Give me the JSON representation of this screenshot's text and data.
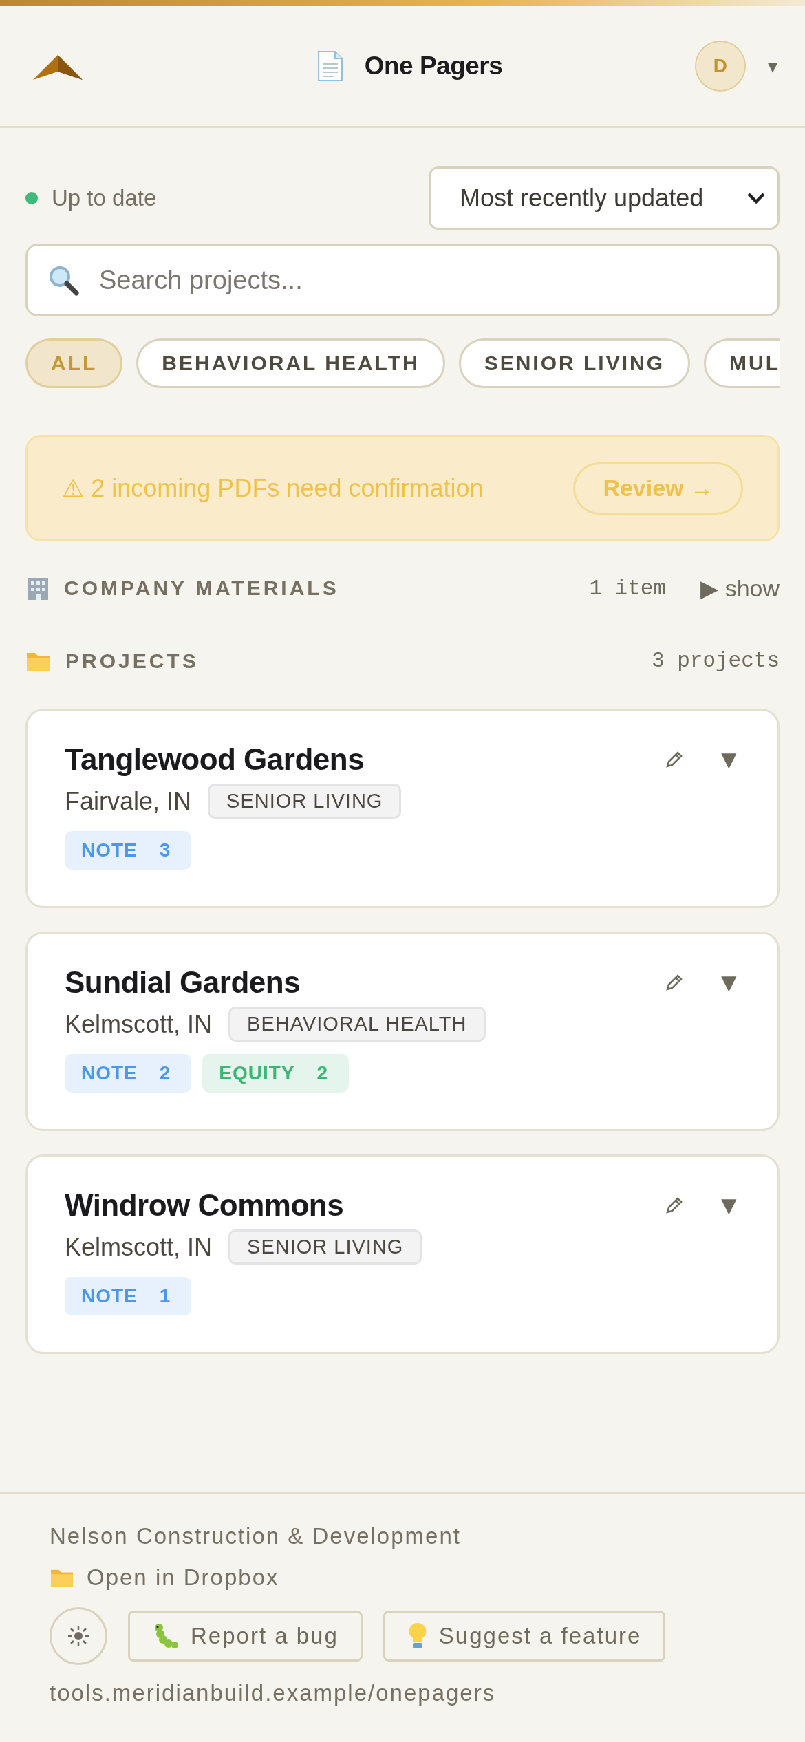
{
  "header": {
    "title": "One Pagers",
    "avatar": "D",
    "menu_caret": "▾"
  },
  "status": {
    "label": "Up to date",
    "color": "#3dbb7a"
  },
  "sort": {
    "value": "Most recently updated"
  },
  "search": {
    "placeholder": "Search projects..."
  },
  "filters": [
    {
      "label": "ALL",
      "selected": true
    },
    {
      "label": "BEHAVIORAL HEALTH",
      "selected": false
    },
    {
      "label": "SENIOR LIVING",
      "selected": false
    },
    {
      "label": "MUL",
      "selected": false
    }
  ],
  "alert": {
    "message": "⚠ 2 incoming PDFs need confirmation",
    "action": "Review →"
  },
  "company_materials": {
    "title": "COMPANY MATERIALS",
    "count": "1 item",
    "toggle": "▶ show"
  },
  "projects": {
    "title": "PROJECTS",
    "count": "3 projects",
    "items": [
      {
        "name": "Tanglewood Gardens",
        "location": "Fairvale, IN",
        "category": "SENIOR LIVING",
        "expand": "▼",
        "tags": [
          {
            "kind": "note",
            "label": "NOTE",
            "count": "3"
          }
        ]
      },
      {
        "name": "Sundial Gardens",
        "location": "Kelmscott, IN",
        "category": "BEHAVIORAL HEALTH",
        "expand": "▼",
        "tags": [
          {
            "kind": "note",
            "label": "NOTE",
            "count": "2"
          },
          {
            "kind": "equity",
            "label": "EQUITY",
            "count": "2"
          }
        ]
      },
      {
        "name": "Windrow Commons",
        "location": "Kelmscott, IN",
        "category": "SENIOR LIVING",
        "expand": "▼",
        "tags": [
          {
            "kind": "note",
            "label": "NOTE",
            "count": "1"
          }
        ]
      }
    ]
  },
  "footer": {
    "company": "Nelson Construction & Development",
    "dropbox": "Open in Dropbox",
    "bug": "Report a bug",
    "feature": "Suggest a feature",
    "url": "tools.meridianbuild.example/onepagers"
  }
}
